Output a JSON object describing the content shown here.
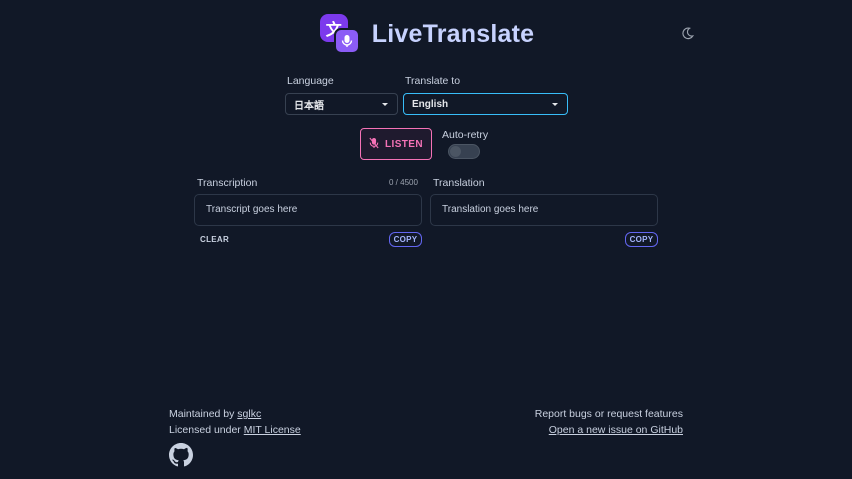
{
  "header": {
    "title": "LiveTranslate",
    "logo_glyph": "文",
    "theme_icon": "moon-icon"
  },
  "language": {
    "label": "Language",
    "selected": "日本語"
  },
  "translate_to": {
    "label": "Translate to",
    "selected": "English"
  },
  "listen": {
    "label": "LISTEN",
    "icon": "mic-off-icon"
  },
  "auto_retry": {
    "label": "Auto-retry",
    "enabled": false
  },
  "transcription": {
    "label": "Transcription",
    "counter": "0 / 4500",
    "placeholder": "Transcript goes here",
    "clear_label": "CLEAR",
    "copy_label": "COPY"
  },
  "translation": {
    "label": "Translation",
    "placeholder": "Translation goes here",
    "copy_label": "COPY"
  },
  "footer": {
    "maintained_prefix": "Maintained by ",
    "maintainer": "sglkc",
    "license_prefix": "Licensed under ",
    "license": "MIT License",
    "report_text": "Report bugs or request features",
    "issue_link": "Open a new issue on GitHub",
    "github_icon": "github-icon"
  },
  "colors": {
    "background": "#111827",
    "accent_purple": "#7c3aed",
    "listen_pink": "#f472b6",
    "select_focus": "#38bdf8",
    "copy_indigo": "#6366f1"
  }
}
